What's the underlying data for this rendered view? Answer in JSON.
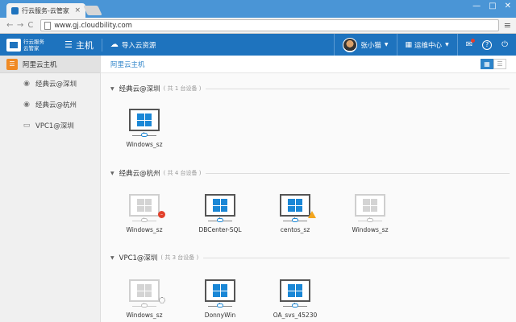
{
  "browser": {
    "tab_title": "行云服务-云管家",
    "tab_close": "×",
    "url": "www.gj.cloudbility.com",
    "nav_back": "←",
    "nav_forward": "→",
    "nav_reload": "C",
    "menu": "≡",
    "window_controls": {
      "minimize": "—",
      "maximize": "□",
      "close": "✕"
    }
  },
  "header": {
    "logo_line1": "行云服务",
    "logo_line2": "云管家",
    "main_label": "主机",
    "import_label": "导入云资源",
    "user_name": "张小猫",
    "ops_label": "运维中心",
    "help": "?",
    "accent": "#1e73be"
  },
  "sidebar": {
    "top": "阿里云主机",
    "items": [
      {
        "label": "经典云@深圳",
        "icon": "map-pin-icon"
      },
      {
        "label": "经典云@杭州",
        "icon": "map-pin-icon"
      },
      {
        "label": "VPC1@深圳",
        "icon": "vpc-icon"
      }
    ]
  },
  "main": {
    "breadcrumb": "阿里云主机",
    "groups": [
      {
        "name": "经典云@深圳",
        "count": "( 共 1 台设备 )",
        "devices": [
          {
            "name": "Windows_sz",
            "state": "running"
          }
        ]
      },
      {
        "name": "经典云@杭州",
        "count": "( 共 4 台设备 )",
        "devices": [
          {
            "name": "Windows_sz",
            "state": "error"
          },
          {
            "name": "DBCenter-SQL",
            "state": "running"
          },
          {
            "name": "centos_sz",
            "state": "warning"
          },
          {
            "name": "Windows_sz",
            "state": "offline"
          }
        ]
      },
      {
        "name": "VPC1@深圳",
        "count": "( 共 3 台设备 )",
        "devices": [
          {
            "name": "Windows_sz",
            "state": "loading"
          },
          {
            "name": "DonnyWin",
            "state": "running"
          },
          {
            "name": "OA_svs_45230",
            "state": "running"
          }
        ]
      }
    ]
  },
  "colors": {
    "brand": "#1e73be",
    "error": "#e2412c",
    "warning": "#f3a51d",
    "sidebar_icon": "#f08a24"
  }
}
